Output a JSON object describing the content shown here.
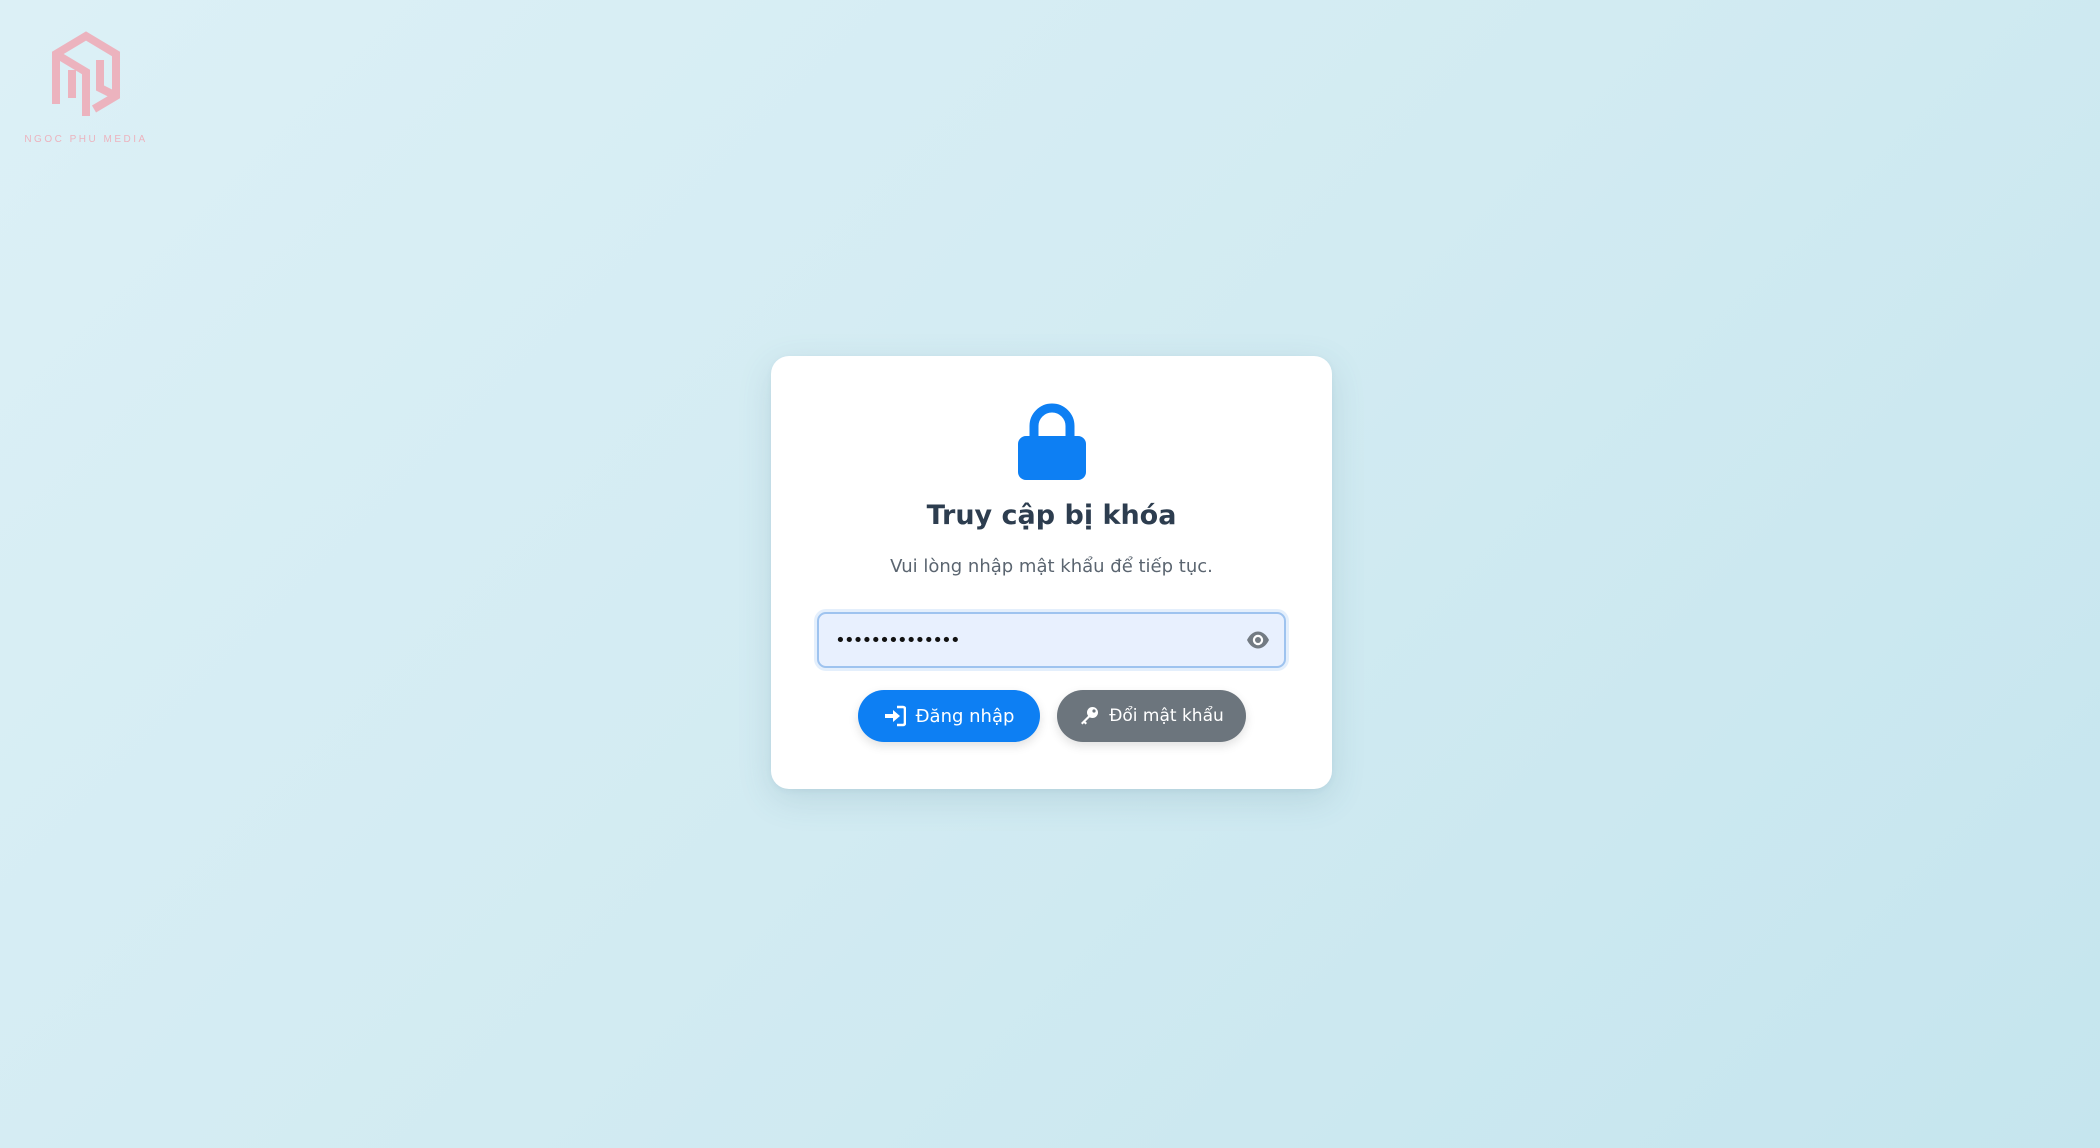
{
  "brand": {
    "name": "NGOC PHU MEDIA",
    "logo_icon": "np-hexagon-logo-icon",
    "color": "#ecb3be"
  },
  "card": {
    "lock_icon": "lock-icon",
    "title": "Truy cập bị khóa",
    "subtitle": "Vui lòng nhập mật khẩu để tiếp tục."
  },
  "password_field": {
    "masked_value": "••••••••••••••",
    "toggle_icon": "eye-icon"
  },
  "buttons": {
    "login_label": "Đăng nhập",
    "login_icon": "sign-in-icon",
    "change_password_label": "Đổi mật khẩu",
    "change_password_icon": "key-icon"
  },
  "colors": {
    "primary": "#0d7ff3",
    "secondary": "#6c757d",
    "title": "#2d3d4f"
  }
}
